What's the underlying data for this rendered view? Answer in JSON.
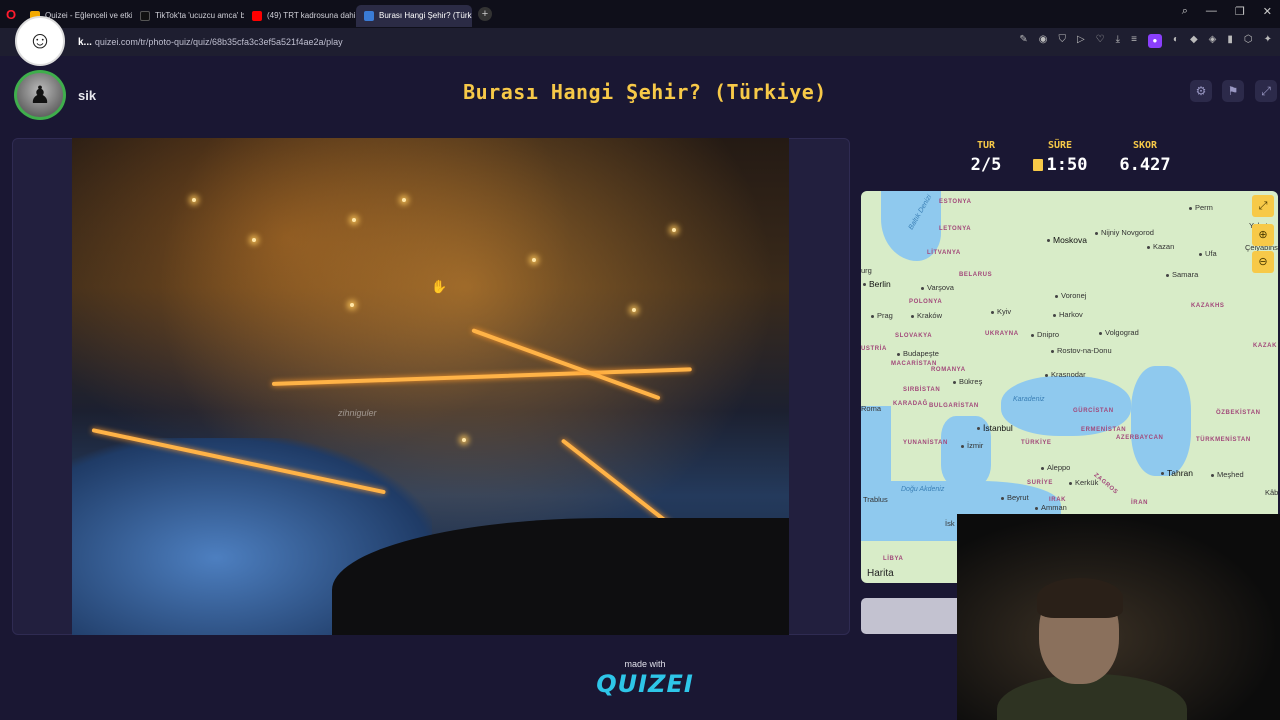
{
  "browser": {
    "tabs": [
      {
        "label": "Quizei - Eğlenceli ve etkile",
        "color": "#f2a900",
        "active": false
      },
      {
        "label": "TikTok'ta 'ucuzcu amca' b",
        "color": "#111111",
        "active": false
      },
      {
        "label": "(49) TRT kadrosuna dahil",
        "color": "#ff0000",
        "active": false
      },
      {
        "label": "Burası Hangi Şehir? (Türk",
        "color": "#3a7bd5",
        "active": true
      }
    ],
    "url_host": "k...",
    "url": "quizei.com/tr/photo-quiz/quiz/68b35cfa3c3ef5a521f4ae2a/play"
  },
  "user": {
    "name": "sik"
  },
  "header": {
    "title": "Burası Hangi Şehir? (Türkiye)"
  },
  "stats": {
    "round_label": "TUR",
    "round_value": "2/5",
    "time_label": "SÜRE",
    "time_value": "1:50",
    "score_label": "SKOR",
    "score_value": "6.427"
  },
  "photo": {
    "watermark": "zihniguler"
  },
  "map": {
    "attribution": "Harita",
    "labels": {
      "estonya": "ESTONYA",
      "letonya": "LETONYA",
      "litvanya": "LİTVANYA",
      "belarus": "BELARUS",
      "polonya": "POLONYA",
      "ukrayna": "UKRAYNA",
      "slovakya": "SLOVAKYA",
      "macaristan": "MACARİSTAN",
      "romanya": "ROMANYA",
      "sirbistan": "SIRBİSTAN",
      "bulgaristan": "BULGARİSTAN",
      "karadag": "KARADAĞ",
      "yunanistan": "YUNANİSTAN",
      "turkiye": "TÜRKİYE",
      "gurcistan": "GÜRCİSTAN",
      "ermenistan": "ERMENİSTAN",
      "azerbaycan": "AZERBAYCAN",
      "kazakhstan": "KAZAKHS",
      "ozbekistan": "ÖZBEKİSTAN",
      "turkmenistan": "TÜRKMENİSTAN",
      "irak": "IRAK",
      "iran": "İRAN",
      "libya": "LİBYA",
      "suriye": "SURİYE",
      "zagros": "ZAGROS",
      "kazak_edge": "KAZAK",
      "ustria": "USTRİA",
      "baltik": "Baltık Denizi",
      "karadeniz": "Karadeniz",
      "dogu_akdeniz": "Doğu Akdeniz",
      "perm": "Perm",
      "yekate": "Yekate",
      "celyabinsk": "Çelyabinsk",
      "moskova": "Moskova",
      "nizhny": "Nijniy Novgorod",
      "kazan": "Kazan",
      "ufa": "Ufa",
      "samara": "Samara",
      "berlin": "Berlin",
      "varsova": "Varşova",
      "prag": "Prag",
      "krakow": "Kraków",
      "kyiv": "Kyiv",
      "harkov": "Harkov",
      "voronej": "Voronej",
      "dnipro": "Dnipro",
      "volgograd": "Volgograd",
      "budapeste": "Budapeşte",
      "rostov": "Rostov-na-Donu",
      "krasnodar": "Krasnodar",
      "bukres": "Bükreş",
      "istanbul": "İstanbul",
      "izmir": "İzmir",
      "roma": "Roma",
      "tahran": "Tahran",
      "meshed": "Meşhed",
      "aleppo": "Aleppo",
      "kerkuk": "Kerkük",
      "beyrut": "Beyrut",
      "amman": "Amman",
      "trablus": "Trablus",
      "isk": "İsk",
      "kab": "Kâb",
      "urg": "urg"
    }
  },
  "footer": {
    "made_with": "made with",
    "logo": "QUIZEI"
  }
}
